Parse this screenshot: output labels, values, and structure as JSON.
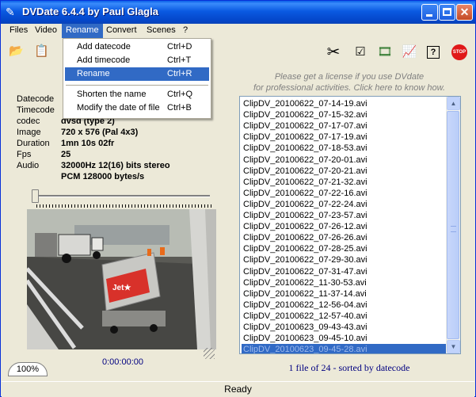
{
  "window": {
    "title": "DVDate 6.4.4 by Paul Glagla"
  },
  "menu": [
    {
      "label": "Files"
    },
    {
      "label": "Video"
    },
    {
      "label": "Rename"
    },
    {
      "label": "Convert"
    },
    {
      "label": "Scenes"
    },
    {
      "label": "?"
    }
  ],
  "rename_menu": {
    "items": [
      {
        "label": "Add datecode",
        "shortcut": "Ctrl+D"
      },
      {
        "label": "Add timecode",
        "shortcut": "Ctrl+T"
      },
      {
        "label": "Rename",
        "shortcut": "Ctrl+R"
      },
      {
        "label": "Shorten the name",
        "shortcut": "Ctrl+Q"
      },
      {
        "label": "Modify the date of file",
        "shortcut": "Ctrl+B"
      }
    ]
  },
  "toolbar": {
    "icons": [
      "open-folder-icon",
      "paste-icon",
      "cut-icon",
      "checkmark-icon",
      "film-icon",
      "chart-icon",
      "help-icon",
      "stop-icon"
    ],
    "stop_label": "STOP"
  },
  "info": {
    "labels": [
      "Datecode",
      "Timecode",
      "codec",
      "Image",
      "Duration",
      "Fps",
      "Audio"
    ],
    "values": {
      "codec": "dvsd (type 2)",
      "image": "720 x 576 (Pal 4x3)",
      "duration": "1mn 10s 02fr",
      "fps": "25",
      "audio_line1": "32000Hz 12(16) bits  stereo",
      "audio_line2": "PCM 128000 bytes/s"
    }
  },
  "notice": {
    "line1": "Please get a license if you use DVdate",
    "line2": "for professional activities. Click here to know how."
  },
  "files": [
    "ClipDV_20100622_07-14-19.avi",
    "ClipDV_20100622_07-15-32.avi",
    "ClipDV_20100622_07-17-07.avi",
    "ClipDV_20100622_07-17-19.avi",
    "ClipDV_20100622_07-18-53.avi",
    "ClipDV_20100622_07-20-01.avi",
    "ClipDV_20100622_07-20-21.avi",
    "ClipDV_20100622_07-21-32.avi",
    "ClipDV_20100622_07-22-16.avi",
    "ClipDV_20100622_07-22-24.avi",
    "ClipDV_20100622_07-23-57.avi",
    "ClipDV_20100622_07-26-12.avi",
    "ClipDV_20100622_07-26-26.avi",
    "ClipDV_20100622_07-28-25.avi",
    "ClipDV_20100622_07-29-30.avi",
    "ClipDV_20100622_07-31-47.avi",
    "ClipDV_20100622_11-30-53.avi",
    "ClipDV_20100622_11-37-14.avi",
    "ClipDV_20100622_12-56-04.avi",
    "ClipDV_20100622_12-57-40.avi",
    "ClipDV_20100623_09-43-43.avi",
    "ClipDV_20100623_09-45-10.avi",
    "ClipDV_20100623_09-45-28.avi"
  ],
  "selected_index": 22,
  "file_count_text": "1 file of 24 - sorted by datecode",
  "player": {
    "timecode": "0:00:00:00",
    "zoom": "100%",
    "video_logo": "Jet★"
  },
  "status": "Ready",
  "colors": {
    "titlebar": "#0a5ae2",
    "selection": "#316ac5",
    "accent_text": "#000080"
  }
}
